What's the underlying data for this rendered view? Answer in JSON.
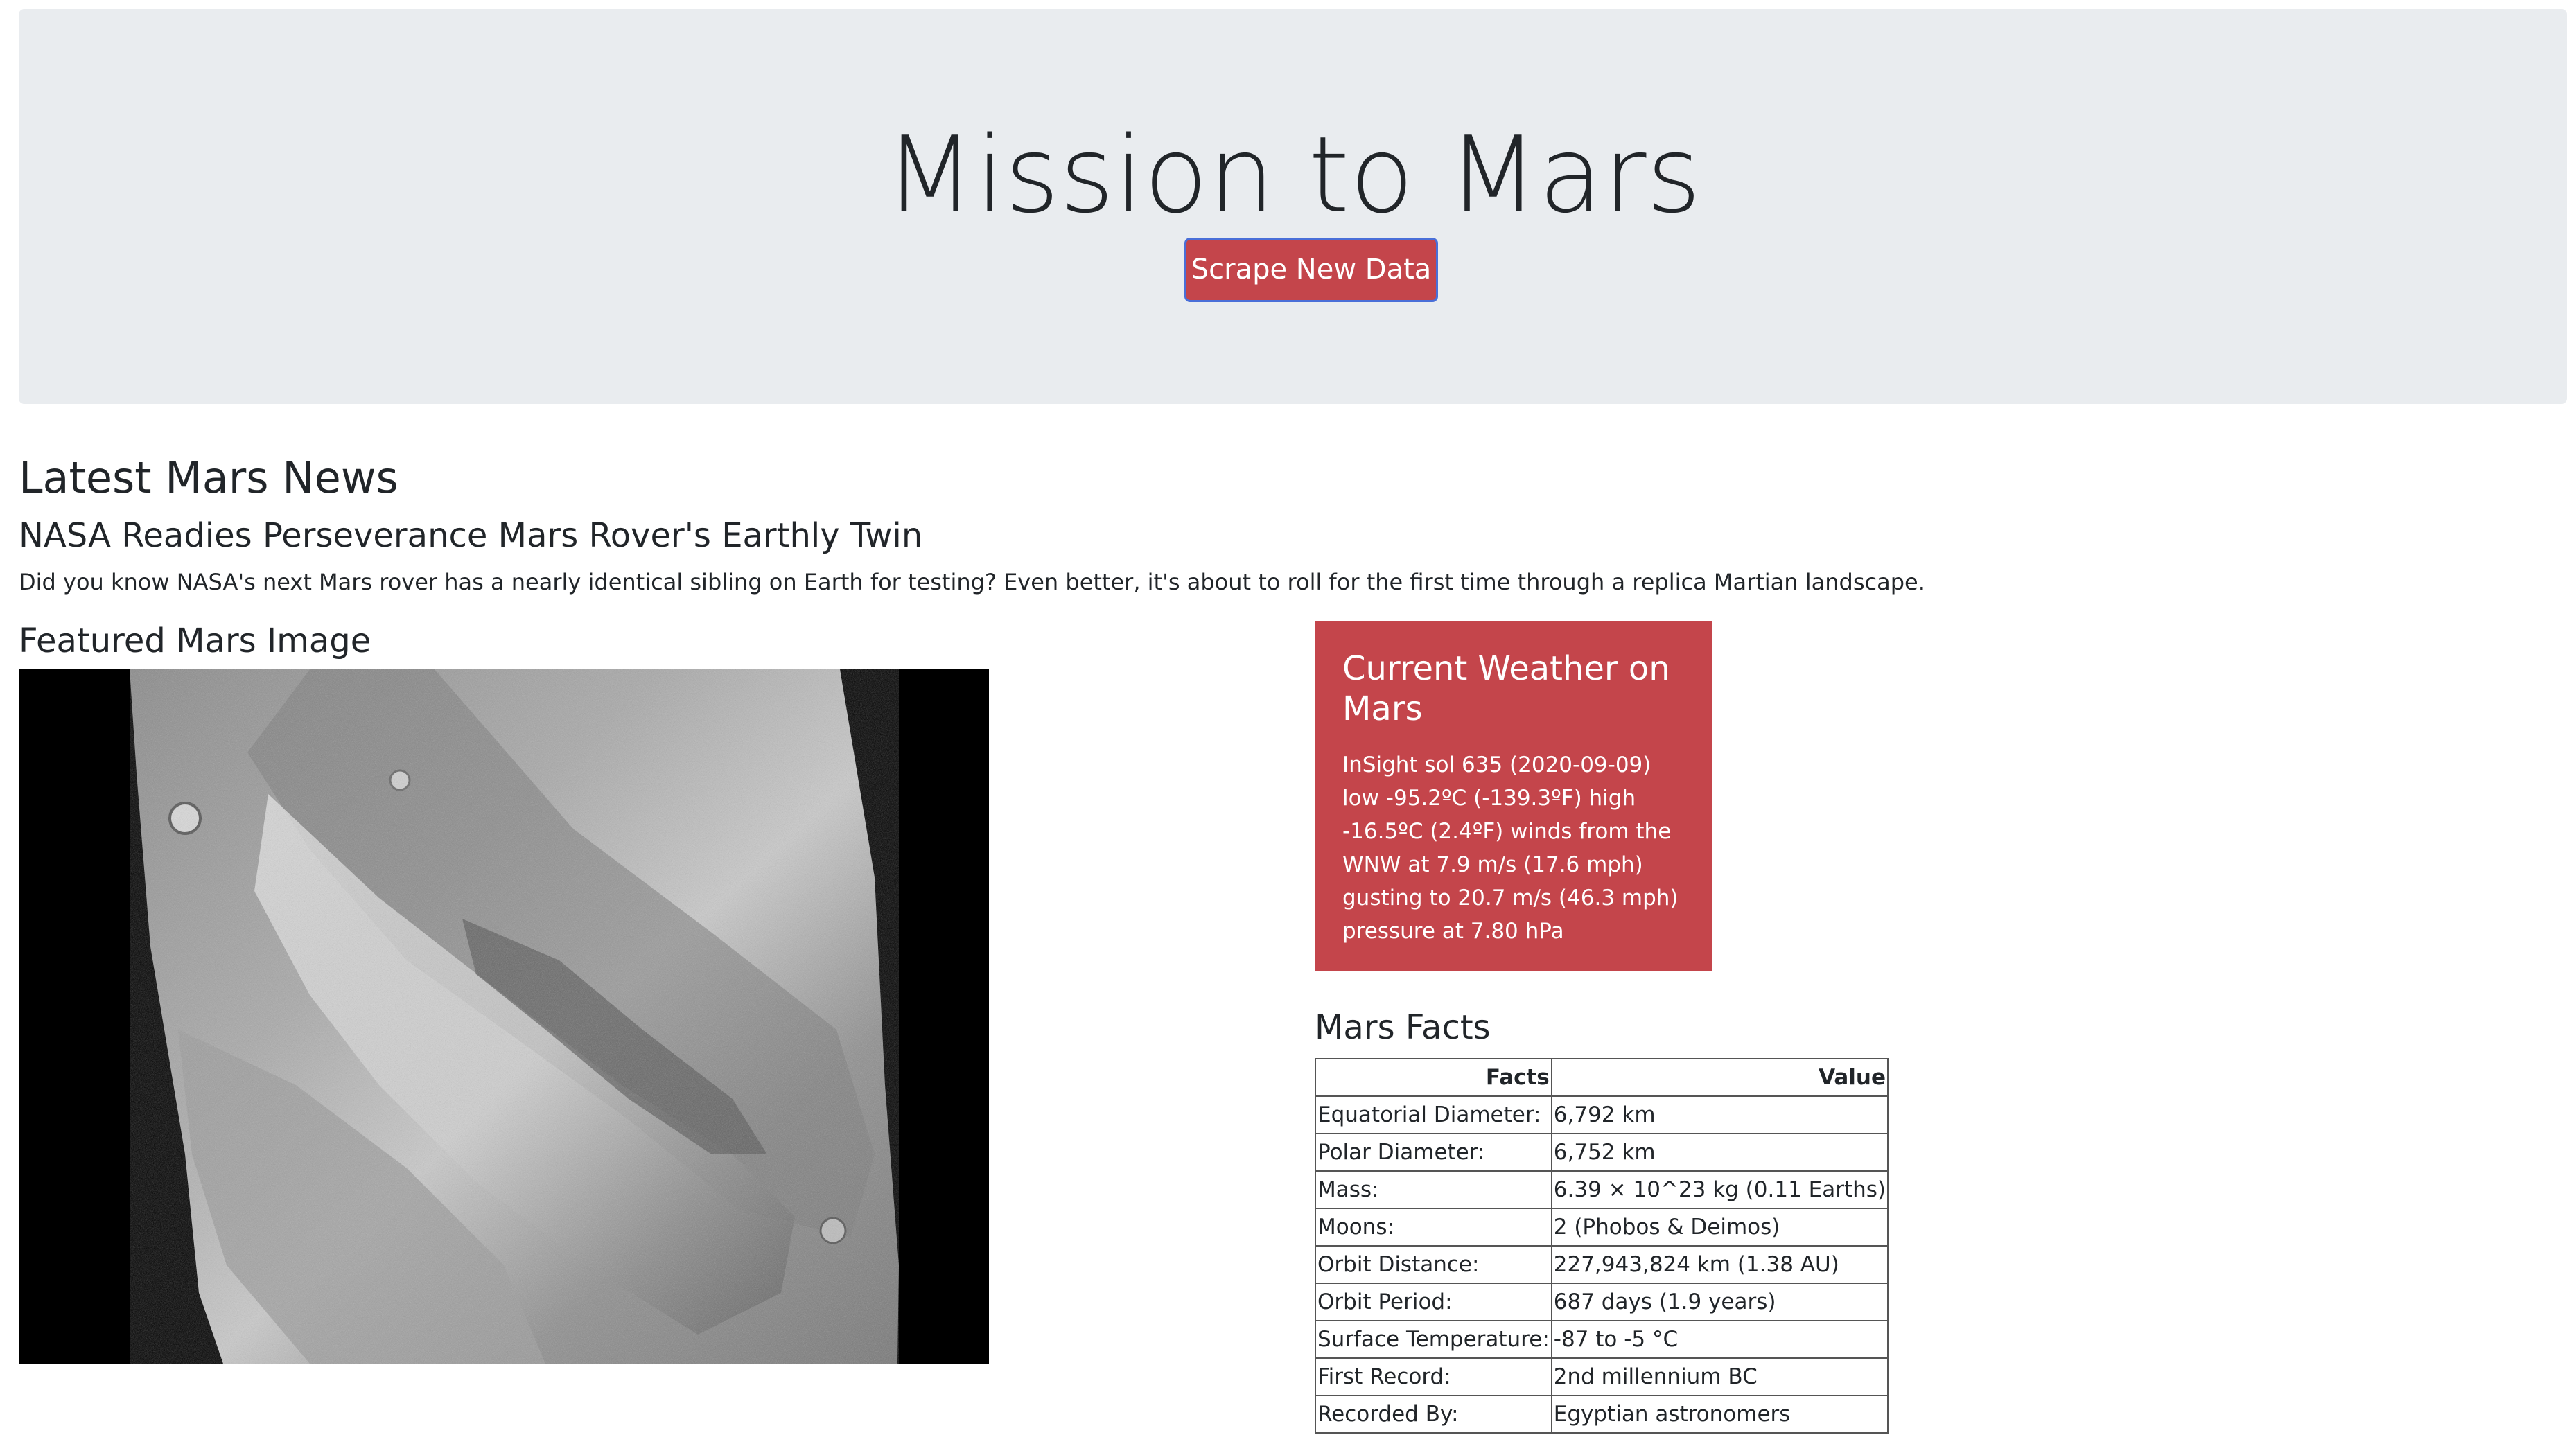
{
  "header": {
    "title": "Mission to Mars",
    "scrape_button": "Scrape New Data"
  },
  "news": {
    "section_title": "Latest Mars News",
    "headline": "NASA Readies Perseverance Mars Rover's Earthly Twin",
    "teaser": "Did you know NASA's next Mars rover has a nearly identical sibling on Earth for testing? Even better, it's about to roll for the first time through a replica Martian landscape."
  },
  "featured_image": {
    "section_title": "Featured Mars Image"
  },
  "weather": {
    "title": "Current Weather on Mars",
    "body": "InSight sol 635 (2020-09-09) low -95.2ºC (-139.3ºF) high -16.5ºC (2.4ºF) winds from the WNW at 7.9 m/s (17.6 mph) gusting to 20.7 m/s (46.3 mph) pressure at 7.80 hPa"
  },
  "facts": {
    "section_title": "Mars Facts",
    "columns": [
      "Facts",
      "Value"
    ],
    "rows": [
      [
        "Equatorial Diameter:",
        "6,792 km"
      ],
      [
        "Polar Diameter:",
        "6,752 km"
      ],
      [
        "Mass:",
        "6.39 × 10^23 kg (0.11 Earths)"
      ],
      [
        "Moons:",
        "2 (Phobos & Deimos)"
      ],
      [
        "Orbit Distance:",
        "227,943,824 km (1.38 AU)"
      ],
      [
        "Orbit Period:",
        "687 days (1.9 years)"
      ],
      [
        "Surface Temperature:",
        "-87 to -5 °C"
      ],
      [
        "First Record:",
        "2nd millennium BC"
      ],
      [
        "Recorded By:",
        "Egyptian astronomers"
      ]
    ]
  },
  "colors": {
    "jumbotron_bg": "#e9ecef",
    "accent_red": "#c4454b",
    "button_border": "#4a6fd8"
  }
}
